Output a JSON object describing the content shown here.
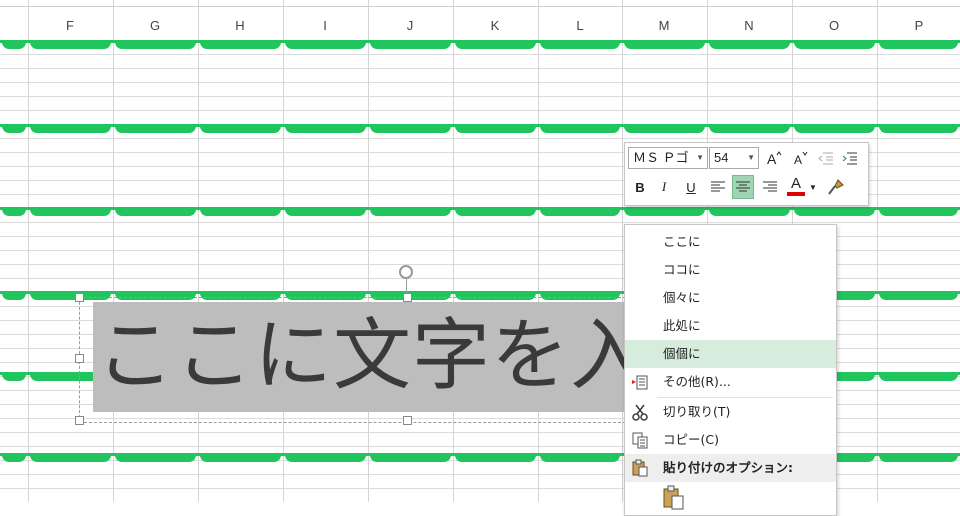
{
  "columns": [
    "F",
    "G",
    "H",
    "I",
    "J",
    "K",
    "L",
    "M",
    "N",
    "O",
    "P"
  ],
  "textbox": {
    "text": "ここに文字を入"
  },
  "mini_toolbar": {
    "font_name": "ＭＳ Ｐゴ",
    "font_size": "54",
    "bold": "B",
    "italic": "I",
    "underline": "U",
    "font_color": "A"
  },
  "context_menu": {
    "items": [
      {
        "label": "ここに"
      },
      {
        "label": "ココに"
      },
      {
        "label": "個々に"
      },
      {
        "label": "此処に"
      },
      {
        "label": "個個に"
      },
      {
        "label": "その他(R)..."
      },
      {
        "label": "切り取り(T)"
      },
      {
        "label": "コピー(C)"
      },
      {
        "label": "貼り付けのオプション:"
      }
    ]
  },
  "colors": {
    "accent_green": "#21c55d",
    "highlight": "#d6ecdc"
  }
}
